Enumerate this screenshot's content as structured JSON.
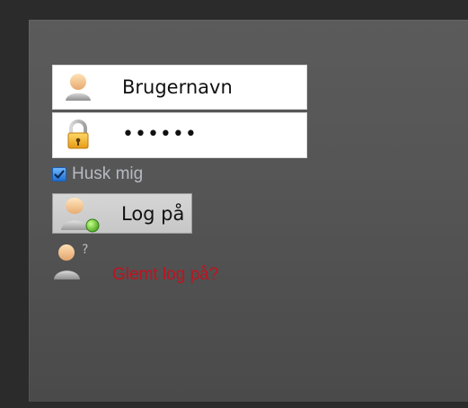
{
  "login": {
    "username_value": "Brugernavn",
    "password_value": "••••••",
    "remember_label": "Husk mig",
    "remember_checked": true,
    "login_button_label": "Log på",
    "forgot_link_label": "Glemt log på?"
  },
  "icons": {
    "username": "user-icon",
    "password": "padlock-icon",
    "remember": "checkbox-checked-icon",
    "login": "user-online-icon",
    "forgot": "user-question-icon"
  },
  "colors": {
    "panel": "#555555",
    "forgot_link": "#c1121f",
    "remember_label": "#b7bac3",
    "checkbox": "#1f6fd1"
  }
}
